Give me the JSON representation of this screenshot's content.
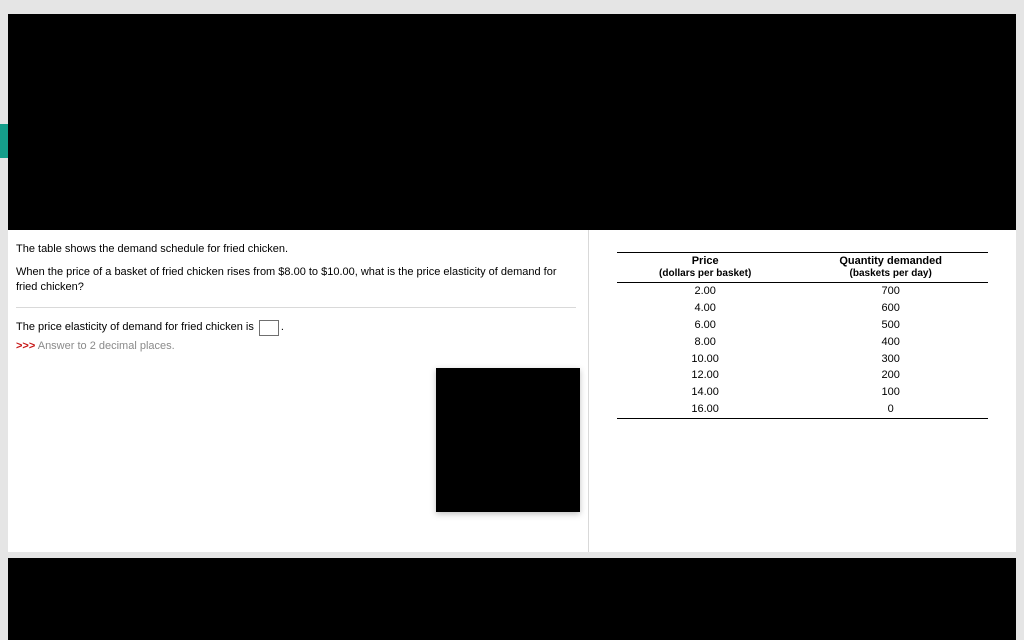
{
  "question": {
    "intro": "The table shows the demand schedule for fried chicken.",
    "prompt": "When the price of a basket of fried chicken rises from $8.00 to $10.00, what is the price elasticity of demand for fried chicken?",
    "answer_prefix": "The price elasticity of demand for fried chicken is ",
    "answer_suffix": ".",
    "hint_prefix": ">>>",
    "hint_text": " Answer to 2 decimal places."
  },
  "table": {
    "headers": {
      "price_title": "Price",
      "price_sub": "(dollars per basket)",
      "qty_title": "Quantity demanded",
      "qty_sub": "(baskets per day)"
    },
    "rows": [
      {
        "price": "2.00",
        "qty": "700"
      },
      {
        "price": "4.00",
        "qty": "600"
      },
      {
        "price": "6.00",
        "qty": "500"
      },
      {
        "price": "8.00",
        "qty": "400"
      },
      {
        "price": "10.00",
        "qty": "300"
      },
      {
        "price": "12.00",
        "qty": "200"
      },
      {
        "price": "14.00",
        "qty": "100"
      },
      {
        "price": "16.00",
        "qty": "0"
      }
    ]
  },
  "chart_data": {
    "type": "table",
    "title": "Demand schedule for fried chicken",
    "columns": [
      "Price (dollars per basket)",
      "Quantity demanded (baskets per day)"
    ],
    "rows": [
      [
        2.0,
        700
      ],
      [
        4.0,
        600
      ],
      [
        6.0,
        500
      ],
      [
        8.0,
        400
      ],
      [
        10.0,
        300
      ],
      [
        12.0,
        200
      ],
      [
        14.0,
        100
      ],
      [
        16.0,
        0
      ]
    ]
  }
}
